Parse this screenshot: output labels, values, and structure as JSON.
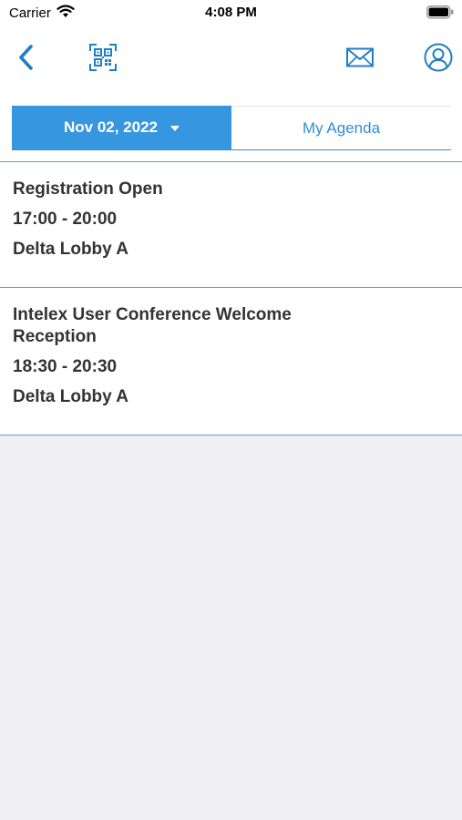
{
  "status_bar": {
    "carrier": "Carrier",
    "time": "4:08 PM"
  },
  "nav": {
    "icons": [
      "back-chevron",
      "qr-scan",
      "envelope",
      "user-profile"
    ],
    "accent_color": "#1f7fc4"
  },
  "segmented": {
    "date_label": "Nov 02, 2022",
    "agenda_label": "My Agenda",
    "active_color": "#3696df"
  },
  "sessions": [
    {
      "title": "Registration Open",
      "time": "17:00 - 20:00",
      "location": "Delta Lobby A"
    },
    {
      "title": "Intelex User Conference Welcome Reception",
      "time": "18:30 - 20:30",
      "location": "Delta Lobby A"
    }
  ]
}
